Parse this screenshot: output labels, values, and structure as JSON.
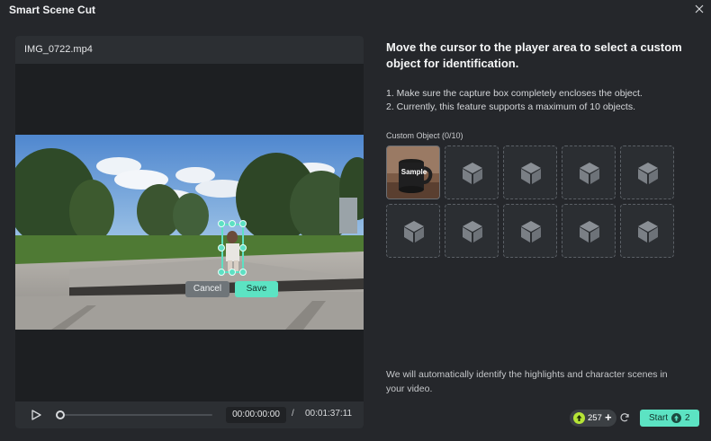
{
  "window": {
    "title": "Smart Scene Cut"
  },
  "player": {
    "file_name": "IMG_0722.mp4",
    "cancel_label": "Cancel",
    "save_label": "Save",
    "current_time": "00:00:00:00",
    "separator": "/",
    "total_time": "00:01:37:11",
    "playback_progress": 0
  },
  "instructions": {
    "heading": "Move the cursor to the player area to select a custom object for identification.",
    "step1": "1. Make sure the capture box completely encloses the object.",
    "step2": "2. Currently, this feature supports a maximum of 10 objects."
  },
  "objects": {
    "label": "Custom Object (0/10)",
    "sample_label": "Sample",
    "empty_slot_icon": "cube-icon",
    "slot_count": 10
  },
  "footer": {
    "note": "We will automatically identify the highlights and character scenes in your video.",
    "credits": "257",
    "start_label": "Start",
    "start_cost": "2"
  },
  "colors": {
    "accent": "#5ce3c3",
    "background": "#25272b",
    "credit_icon": "#b6e536"
  }
}
